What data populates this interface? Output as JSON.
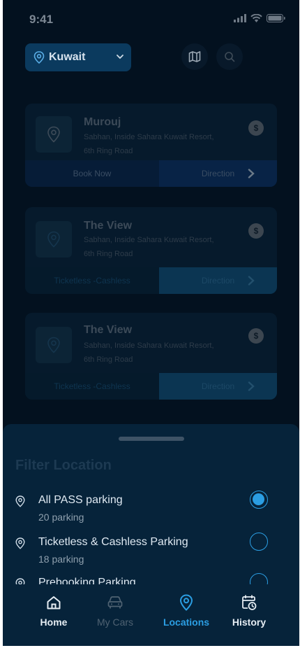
{
  "status": {
    "time": "9:41"
  },
  "header": {
    "country": "Kuwait",
    "icons": [
      "location-pin-icon",
      "chevron-down-icon",
      "map-icon",
      "search-icon"
    ]
  },
  "locations": [
    {
      "title": "Murouj",
      "address": "Sabhan, Inside Sahara Kuwait Resort, 6th Ring Road",
      "fee_symbol": "$",
      "left_action": "Book Now",
      "right_action": "Direction"
    },
    {
      "title": "The View",
      "address": "Sabhan, Inside Sahara Kuwait Resort, 6th Ring Road",
      "fee_symbol": "$",
      "left_action": "Ticketless -Cashless",
      "right_action": "Direction"
    },
    {
      "title": "The View",
      "address": "Sabhan, Inside Sahara Kuwait Resort, 6th Ring Road",
      "fee_symbol": "$",
      "left_action": "Ticketless -Cashless",
      "right_action": "Direction"
    }
  ],
  "filter": {
    "title": "Filter Location",
    "options": [
      {
        "label": "All PASS parking",
        "count": "20 parking",
        "selected": true
      },
      {
        "label": "Ticketless & Cashless Parking",
        "count": "18 parking",
        "selected": false
      },
      {
        "label": "Prebooking Parking",
        "count": "",
        "selected": false
      }
    ]
  },
  "nav": {
    "items": [
      {
        "label": "Home",
        "icon": "home-icon"
      },
      {
        "label": "My Cars",
        "icon": "car-icon"
      },
      {
        "label": "Locations",
        "icon": "location-pin-icon",
        "active": true
      },
      {
        "label": "History",
        "icon": "calendar-clock-icon"
      }
    ]
  },
  "colors": {
    "accent": "#2b9ee3",
    "background": "#03111f",
    "sheet": "#06233a"
  }
}
